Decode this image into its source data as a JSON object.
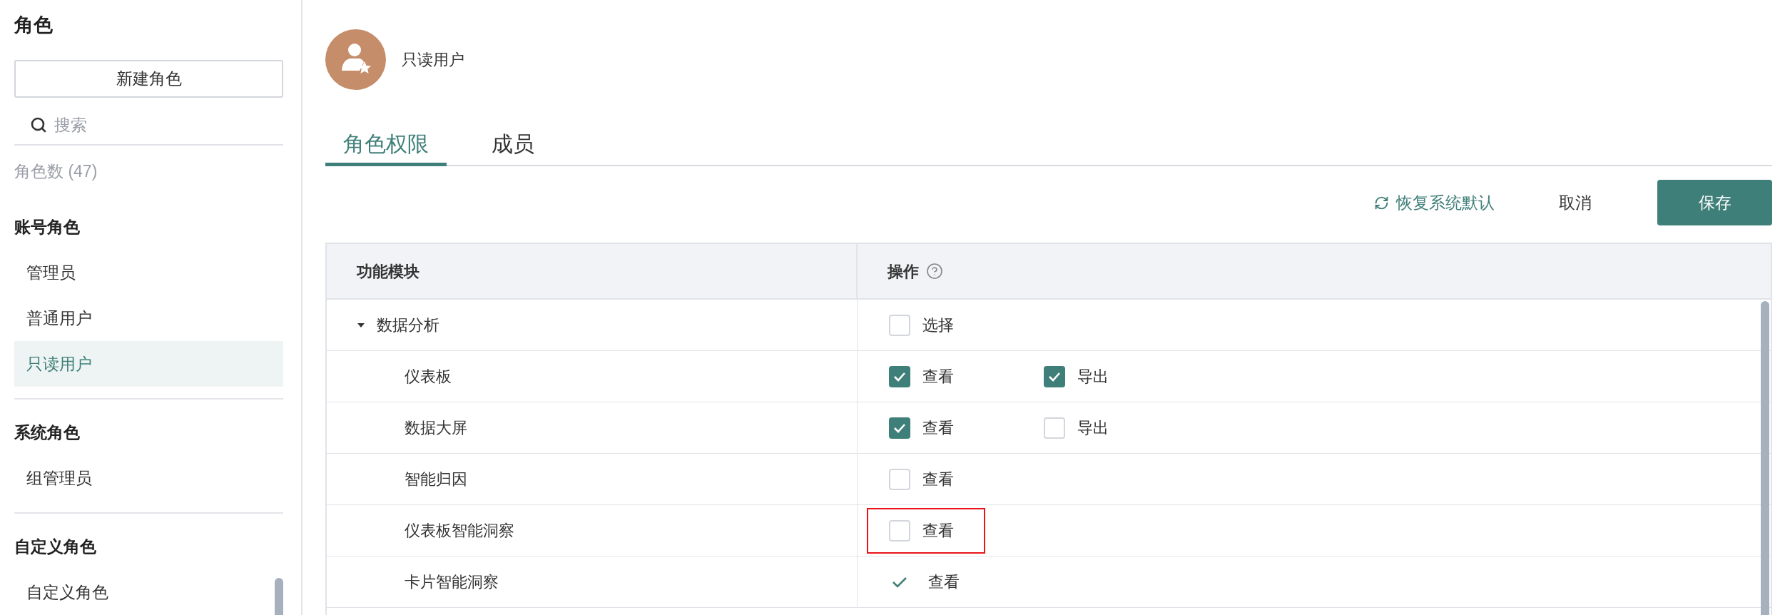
{
  "sidebar": {
    "title": "角色",
    "new_button": "新建角色",
    "search": {
      "placeholder": "搜索"
    },
    "count": "角色数 (47)",
    "groups": [
      {
        "heading": "账号角色",
        "items": [
          {
            "label": "管理员",
            "selected": false
          },
          {
            "label": "普通用户",
            "selected": false
          },
          {
            "label": "只读用户",
            "selected": true
          }
        ]
      },
      {
        "heading": "系统角色",
        "items": [
          {
            "label": "组管理员",
            "selected": false
          }
        ]
      },
      {
        "heading": "自定义角色",
        "items": [
          {
            "label": "自定义角色",
            "selected": false
          }
        ]
      }
    ]
  },
  "header": {
    "name": "只读用户"
  },
  "tabs": [
    {
      "label": "角色权限",
      "selected": true
    },
    {
      "label": "成员",
      "selected": false
    }
  ],
  "toolbar": {
    "reset": "恢复系统默认",
    "cancel": "取消",
    "save": "保存"
  },
  "table": {
    "columns": [
      "功能模块",
      "操作"
    ],
    "rows": [
      {
        "label": "数据分析",
        "expanded": true,
        "actions": [
          {
            "kind": "checkbox",
            "label": "选择",
            "checked": false,
            "highlighted": false
          }
        ],
        "children": [
          {
            "label": "仪表板",
            "actions": [
              {
                "kind": "checkbox",
                "label": "查看",
                "checked": true,
                "highlighted": false
              },
              {
                "kind": "checkbox",
                "label": "导出",
                "checked": true,
                "highlighted": false
              }
            ]
          },
          {
            "label": "数据大屏",
            "actions": [
              {
                "kind": "checkbox",
                "label": "查看",
                "checked": true,
                "highlighted": false
              },
              {
                "kind": "checkbox",
                "label": "导出",
                "checked": false,
                "highlighted": false
              }
            ]
          },
          {
            "label": "智能归因",
            "actions": [
              {
                "kind": "checkbox",
                "label": "查看",
                "checked": false,
                "highlighted": false
              }
            ]
          },
          {
            "label": "仪表板智能洞察",
            "actions": [
              {
                "kind": "checkbox",
                "label": "查看",
                "checked": false,
                "highlighted": true
              }
            ]
          },
          {
            "label": "卡片智能洞察",
            "actions": [
              {
                "kind": "tick",
                "label": "查看",
                "checked": true,
                "highlighted": false
              }
            ]
          }
        ]
      }
    ]
  }
}
